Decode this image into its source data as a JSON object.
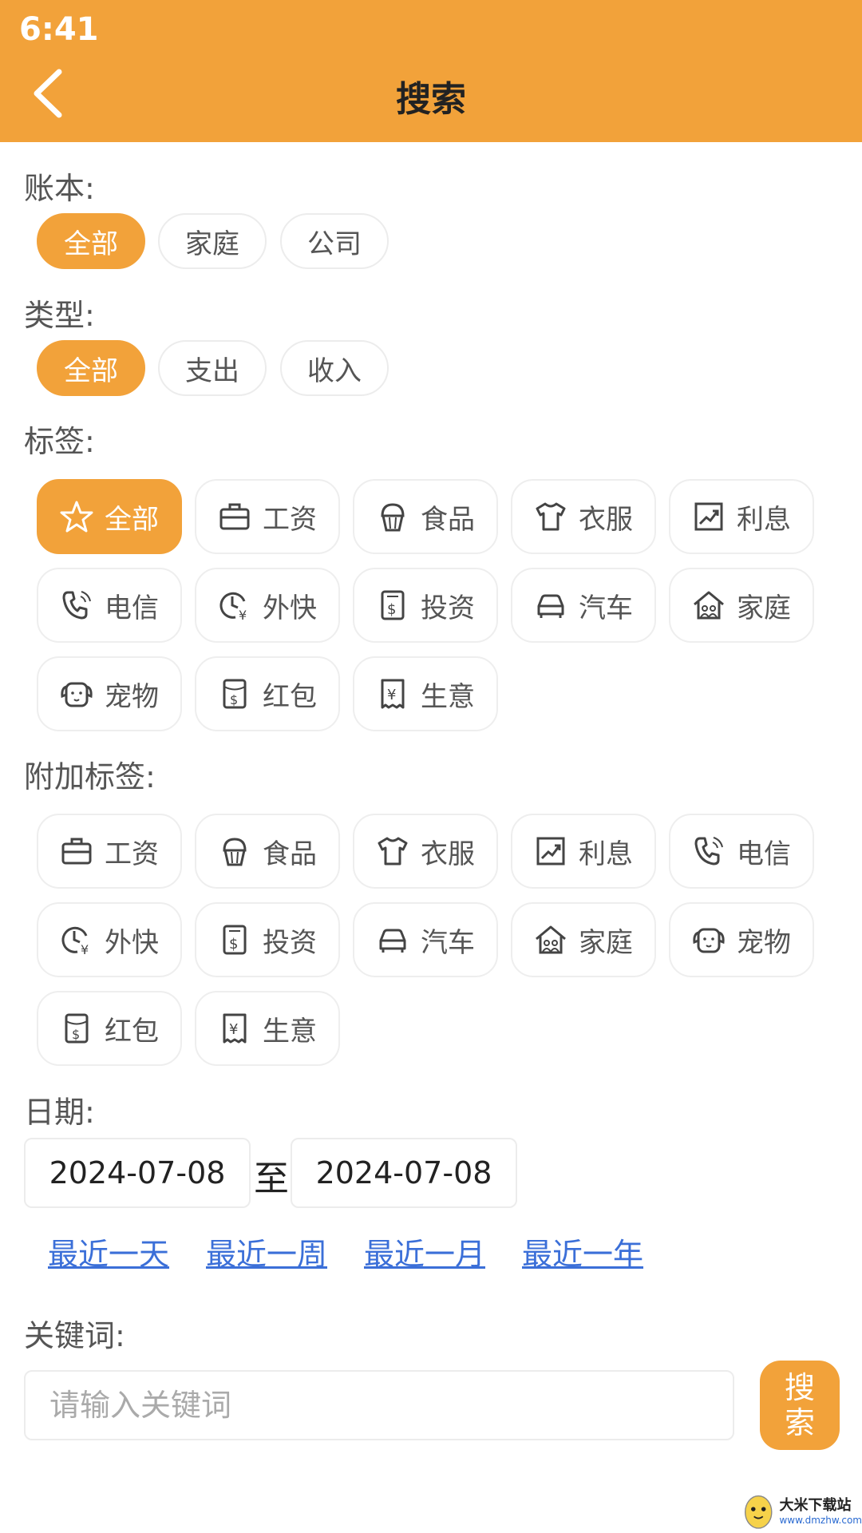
{
  "status_bar": {
    "time": "6:41"
  },
  "header": {
    "title": "搜索"
  },
  "colors": {
    "accent": "#F2A23A",
    "link": "#3b6fd8"
  },
  "ledger": {
    "label": "账本:",
    "options": [
      "全部",
      "家庭",
      "公司"
    ],
    "selected": "全部"
  },
  "type": {
    "label": "类型:",
    "options": [
      "全部",
      "支出",
      "收入"
    ],
    "selected": "全部"
  },
  "tags": {
    "label": "标签:",
    "items": [
      {
        "label": "全部",
        "icon": "star-icon"
      },
      {
        "label": "工资",
        "icon": "briefcase-icon"
      },
      {
        "label": "食品",
        "icon": "cupcake-icon"
      },
      {
        "label": "衣服",
        "icon": "shirt-icon"
      },
      {
        "label": "利息",
        "icon": "trend-chart-icon"
      },
      {
        "label": "电信",
        "icon": "phone-icon"
      },
      {
        "label": "外快",
        "icon": "clock-yen-icon"
      },
      {
        "label": "投资",
        "icon": "dollar-receipt-icon"
      },
      {
        "label": "汽车",
        "icon": "car-icon"
      },
      {
        "label": "家庭",
        "icon": "family-house-icon"
      },
      {
        "label": "宠物",
        "icon": "pet-icon"
      },
      {
        "label": "红包",
        "icon": "red-envelope-icon"
      },
      {
        "label": "生意",
        "icon": "yen-receipt-icon"
      }
    ],
    "selected": "全部"
  },
  "extra_tags": {
    "label": "附加标签:",
    "items": [
      {
        "label": "工资",
        "icon": "briefcase-icon"
      },
      {
        "label": "食品",
        "icon": "cupcake-icon"
      },
      {
        "label": "衣服",
        "icon": "shirt-icon"
      },
      {
        "label": "利息",
        "icon": "trend-chart-icon"
      },
      {
        "label": "电信",
        "icon": "phone-icon"
      },
      {
        "label": "外快",
        "icon": "clock-yen-icon"
      },
      {
        "label": "投资",
        "icon": "dollar-receipt-icon"
      },
      {
        "label": "汽车",
        "icon": "car-icon"
      },
      {
        "label": "家庭",
        "icon": "family-house-icon"
      },
      {
        "label": "宠物",
        "icon": "pet-icon"
      },
      {
        "label": "红包",
        "icon": "red-envelope-icon"
      },
      {
        "label": "生意",
        "icon": "yen-receipt-icon"
      }
    ]
  },
  "date": {
    "label": "日期:",
    "start": "2024-07-08",
    "separator": "至",
    "end": "2024-07-08",
    "quick_ranges": [
      "最近一天",
      "最近一周",
      "最近一月",
      "最近一年"
    ]
  },
  "keyword": {
    "label": "关键词:",
    "placeholder": "请输入关键词",
    "value": "",
    "search_label": "搜索"
  },
  "watermark": {
    "title": "大米下载站",
    "url": "www.dmzhw.com"
  }
}
